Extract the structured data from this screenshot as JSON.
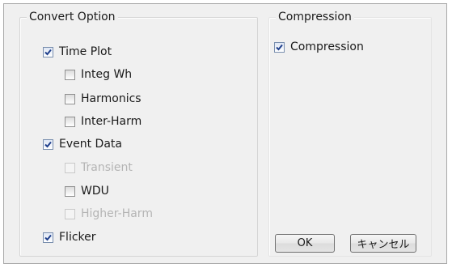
{
  "convert_option": {
    "title": "Convert Option",
    "items": [
      {
        "label": "Time Plot",
        "checked": true,
        "enabled": true
      },
      {
        "label": "Integ Wh",
        "checked": false,
        "enabled": true
      },
      {
        "label": "Harmonics",
        "checked": false,
        "enabled": true
      },
      {
        "label": "Inter-Harm",
        "checked": false,
        "enabled": true
      },
      {
        "label": "Event Data",
        "checked": true,
        "enabled": true
      },
      {
        "label": "Transient",
        "checked": false,
        "enabled": false
      },
      {
        "label": "WDU",
        "checked": false,
        "enabled": true
      },
      {
        "label": "Higher-Harm",
        "checked": false,
        "enabled": false
      },
      {
        "label": "Flicker",
        "checked": true,
        "enabled": true
      }
    ]
  },
  "compression": {
    "title": "Compression",
    "item": {
      "label": "Compression",
      "checked": true,
      "enabled": true
    }
  },
  "buttons": {
    "ok_label": "OK",
    "cancel_label": "キャンセル"
  },
  "colors": {
    "dialog_bg": "#f0f0f0",
    "check_mark": "#1f3f8c",
    "disabled_text": "#b4b4b4"
  }
}
